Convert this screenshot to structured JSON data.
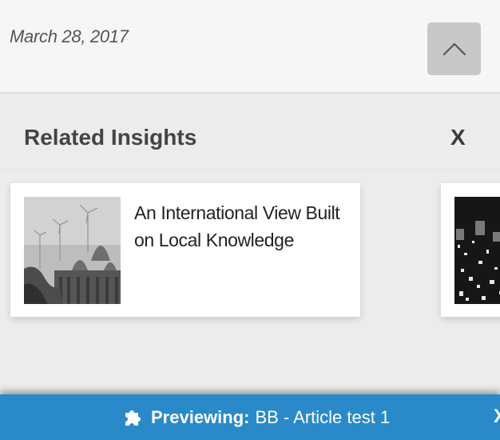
{
  "article": {
    "date": "March 28, 2017"
  },
  "scroll_top": {
    "icon": "chevron-up-icon"
  },
  "related": {
    "title": "Related Insights",
    "close_label": "X",
    "cards": [
      {
        "title": "An International View Built on Local Knowledge",
        "image": "temple-domes-wind-turbines-photo"
      },
      {
        "title": "",
        "image": "city-lights-photo"
      }
    ]
  },
  "preview_bar": {
    "icon": "puzzle-icon",
    "label": "Previewing:",
    "value": "BB - Article test 1",
    "close_label": "X",
    "bg_color": "#2a8ac9"
  }
}
